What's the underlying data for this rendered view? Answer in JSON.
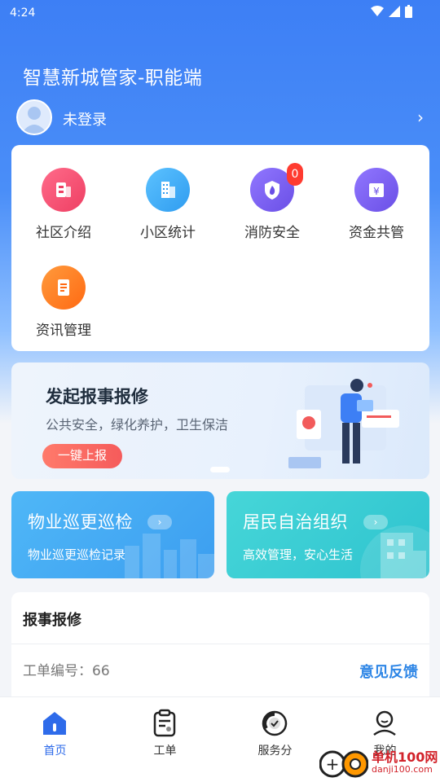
{
  "status_bar": {
    "time": "4:24"
  },
  "header": {
    "title": "智慧新城管家-职能端",
    "user_name": "未登录"
  },
  "menu": {
    "items": [
      {
        "label": "社区介绍",
        "icon": "building-icon",
        "color": "#f24a6e"
      },
      {
        "label": "小区统计",
        "icon": "apartment-icon",
        "color": "#36a7f2"
      },
      {
        "label": "消防安全",
        "icon": "fire-shield-icon",
        "color": "#7a5df0",
        "badge": "0"
      },
      {
        "label": "资金共管",
        "icon": "yuan-wallet-icon",
        "color": "#7a5df0"
      },
      {
        "label": "资讯管理",
        "icon": "news-doc-icon",
        "color": "#ff7a1f"
      }
    ]
  },
  "banner": {
    "title": "发起报事报修",
    "subtitle": "公共安全，绿化养护，卫生保洁",
    "button": "一键上报"
  },
  "tiles": [
    {
      "title": "物业巡更巡检",
      "subtitle": "物业巡更巡检记录"
    },
    {
      "title": "居民自治组织",
      "subtitle": "高效管理，安心生活"
    }
  ],
  "repair": {
    "title": "报事报修",
    "order_label": "工单编号：66",
    "feedback": "意见反馈"
  },
  "tabbar": {
    "items": [
      {
        "label": "首页",
        "active": true
      },
      {
        "label": "工单",
        "active": false
      },
      {
        "label": "服务分",
        "active": false
      },
      {
        "label": "我的",
        "active": false
      }
    ]
  },
  "watermark": {
    "brand": "单机100网",
    "url": "danji100.com"
  },
  "colors": {
    "accent": "#2e6bea",
    "hero": "#3d7ff5",
    "badge": "#ff3b30"
  }
}
